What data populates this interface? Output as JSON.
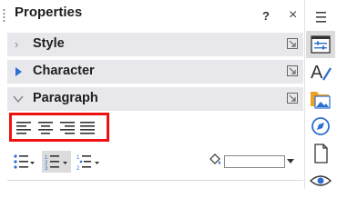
{
  "panel": {
    "title": "Properties",
    "help_label": "?",
    "close_label": "×"
  },
  "sections": [
    {
      "label": "Style",
      "expanded": false
    },
    {
      "label": "Character",
      "expanded": false
    },
    {
      "label": "Paragraph",
      "expanded": true
    }
  ],
  "paragraph": {
    "alignment_buttons": [
      "align-left-icon",
      "align-center-icon",
      "align-right-icon",
      "justify-icon"
    ],
    "list_buttons": [
      "unordered-list-icon",
      "ordered-list-icon",
      "outline-list-icon"
    ],
    "highlight_color": "#ee1111"
  },
  "sidebar_tabs": [
    "menu-icon",
    "properties-icon",
    "styles-icon",
    "gallery-icon",
    "navigator-icon",
    "page-icon",
    "accessibility-icon"
  ]
}
